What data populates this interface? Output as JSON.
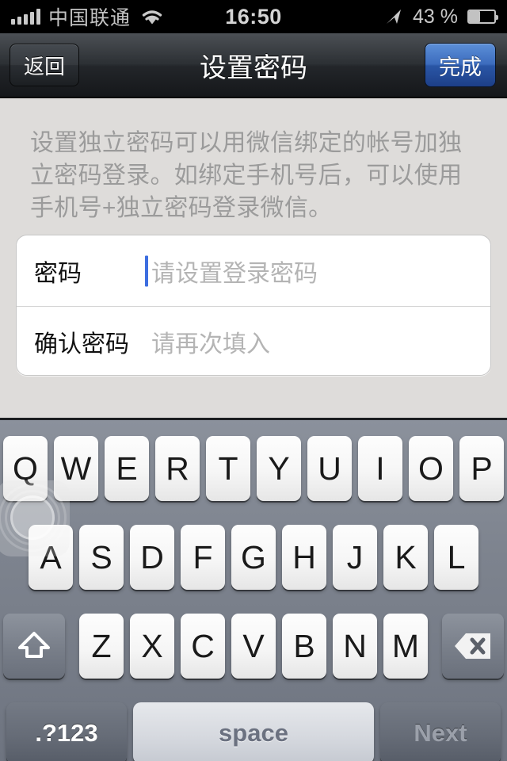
{
  "status_bar": {
    "signal_icon": "signal-bars-icon",
    "signal_bars": 5,
    "carrier": "中国联通",
    "wifi_icon": "wifi-icon",
    "time": "16:50",
    "location_icon": "location-arrow-icon",
    "battery_percent": "43 %",
    "battery_level": 43,
    "battery_icon": "battery-icon"
  },
  "nav": {
    "back_label": "返回",
    "title": "设置密码",
    "done_label": "完成",
    "done_color": "#3c6cbd"
  },
  "content": {
    "description": "设置独立密码可以用微信绑定的帐号加独立密码登录。如绑定手机号后，可以使用手机号+独立密码登录微信。",
    "fields": [
      {
        "label": "密码",
        "value": "",
        "placeholder": "请设置登录密码",
        "focused": true,
        "caret_color": "#3d6ee0"
      },
      {
        "label": "确认密码",
        "value": "",
        "placeholder": "请再次填入",
        "focused": false
      }
    ]
  },
  "keyboard": {
    "row1": [
      "Q",
      "W",
      "E",
      "R",
      "T",
      "Y",
      "U",
      "I",
      "O",
      "P"
    ],
    "row2": [
      "A",
      "S",
      "D",
      "F",
      "G",
      "H",
      "J",
      "K",
      "L"
    ],
    "row3": [
      "Z",
      "X",
      "C",
      "V",
      "B",
      "N",
      "M"
    ],
    "shift_icon": "shift-arrow-icon",
    "backspace_icon": "backspace-delete-icon",
    "numeric_label": ".?123",
    "space_label": "space",
    "return_label": "Next",
    "return_disabled": true
  },
  "overlay": {
    "assistive_touch_icon": "assistive-touch-icon"
  }
}
